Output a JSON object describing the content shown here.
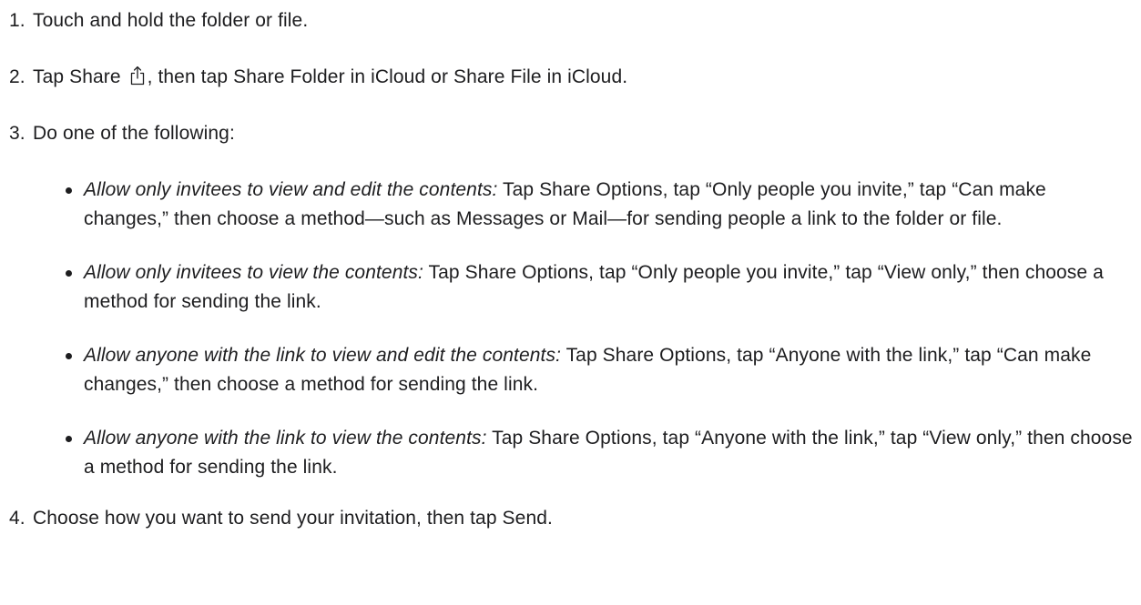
{
  "steps": [
    {
      "num": "1.",
      "text": "Touch and hold the folder or file."
    },
    {
      "num": "2.",
      "text_before": "Tap Share ",
      "icon": "share-icon",
      "text_after": ", then tap Share Folder in iCloud or Share File in iCloud."
    },
    {
      "num": "3.",
      "text": "Do one of the following:"
    },
    {
      "num": "4.",
      "text": "Choose how you want to send your invitation, then tap Send."
    }
  ],
  "options": [
    {
      "label": "Allow only invitees to view and edit the contents:",
      "text": " Tap Share Options, tap “Only people you invite,” tap “Can make changes,” then choose a method—such as Messages or Mail—for sending people a link to the folder or file."
    },
    {
      "label": "Allow only invitees to view the contents:",
      "text": " Tap Share Options, tap “Only people you invite,” tap “View only,” then choose a method for sending the link."
    },
    {
      "label": "Allow anyone with the link to view and edit the contents:",
      "text": " Tap Share Options, tap “Anyone with the link,” tap “Can make changes,” then choose a method for sending the link."
    },
    {
      "label": "Allow anyone with the link to view the contents:",
      "text": " Tap Share Options, tap “Anyone with the link,” tap “View only,” then choose a method for sending the link."
    }
  ]
}
